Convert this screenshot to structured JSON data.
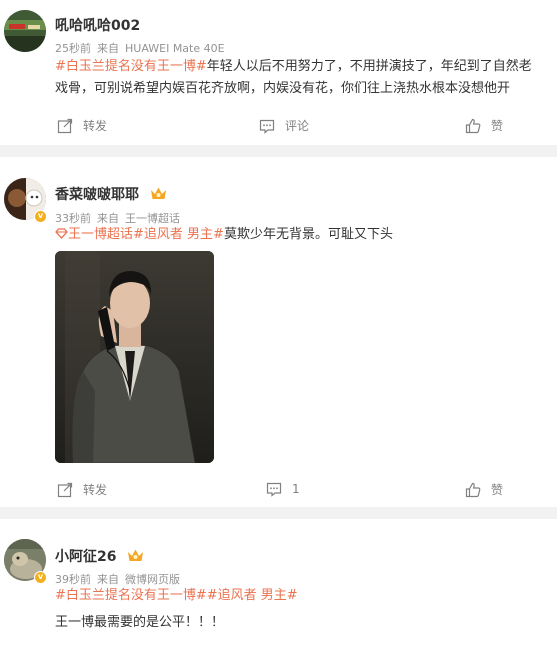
{
  "posts": [
    {
      "username": "吼哈吼哈002",
      "time": "25秒前",
      "source_prefix": "来自",
      "source": "HUAWEI Mate 40E",
      "tag1": "#白玉兰提名没有王一博#",
      "text1": "年轻人以后不用努力了，不用拼演技了，年纪到了自然老戏骨，可别说希望内娱百花齐放啊，内娱没有花，你们往上浇热水根本没想他开",
      "repost_label": "转发",
      "comment_label": "评论",
      "like_label": "赞"
    },
    {
      "username": "香菜啵啵耶耶",
      "time": "33秒前",
      "source_prefix": "来自",
      "source": "王一博超话",
      "tag1": "王一博超话",
      "tag2": "#追风者 男主#",
      "text1": "莫欺少年无背景。可耻又下头",
      "repost_label": "转发",
      "comment_count": "1",
      "like_label": "赞"
    },
    {
      "username": "小阿征26",
      "time": "39秒前",
      "source_prefix": "来自",
      "source": "微博网页版",
      "tag1": "#白玉兰提名没有王一博##追风者 男主#",
      "text1": "王一博最需要的是公平！！！"
    }
  ],
  "colors": {
    "topic": "#eb7350",
    "verified": "#f2b01e",
    "meta": "#939393"
  },
  "icons": [
    "repost-icon",
    "comment-icon",
    "like-icon",
    "crown-icon",
    "super-topic-icon",
    "verified-badge-icon"
  ]
}
